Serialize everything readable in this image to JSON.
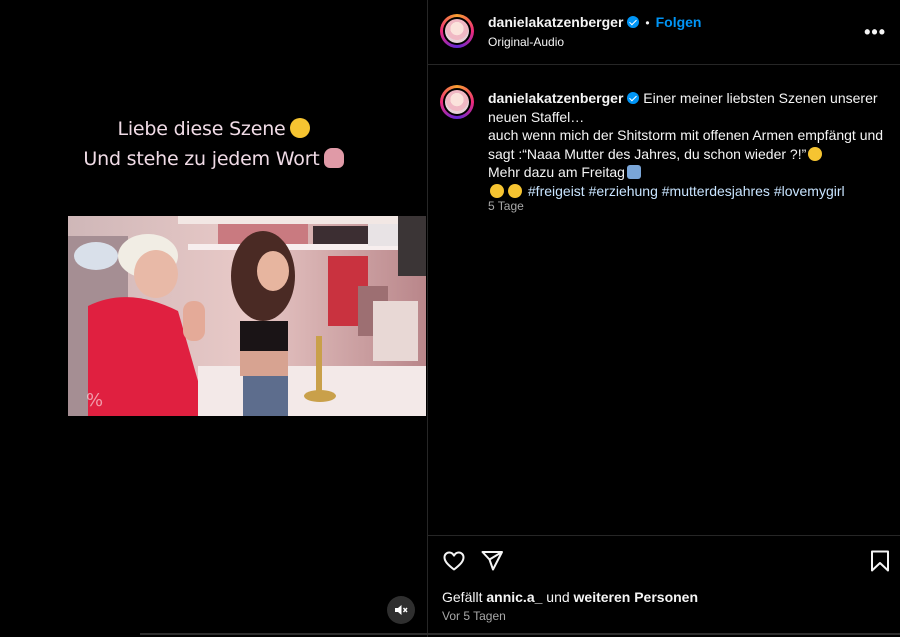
{
  "video": {
    "overlay_line1": "Liebe diese Szene",
    "overlay_line2": "Und stehe zu jedem Wort",
    "mute_icon": "speaker-muted-icon"
  },
  "header": {
    "username": "danielakatzenberger",
    "separator": "•",
    "follow_label": "Folgen",
    "audio_label": "Original-Audio",
    "more_label": "•••"
  },
  "caption": {
    "username": "danielakatzenberger",
    "line1": "Einer meiner liebsten Szenen unserer neuen Staffel…",
    "line2": "auch wenn mich der Shitstorm mit offenen Armen empfängt und sagt :“Naaa Mutter des Jahres, du schon wieder ?!”",
    "line3": "Mehr dazu am Freitag",
    "hashtags": [
      "#freigeist",
      "#erziehung",
      "#mutterdesjahres",
      "#lovemygirl"
    ],
    "time": "5 Tage"
  },
  "footer": {
    "likes_prefix": "Gefällt",
    "liked_by": "annic.a_",
    "likes_middle": "und",
    "likes_suffix": "weiteren Personen",
    "time_ago": "Vor 5 Tagen"
  },
  "colors": {
    "accent": "#0095f6",
    "background": "#000000",
    "muted_text": "#a8a8a8",
    "divider": "#262626"
  }
}
